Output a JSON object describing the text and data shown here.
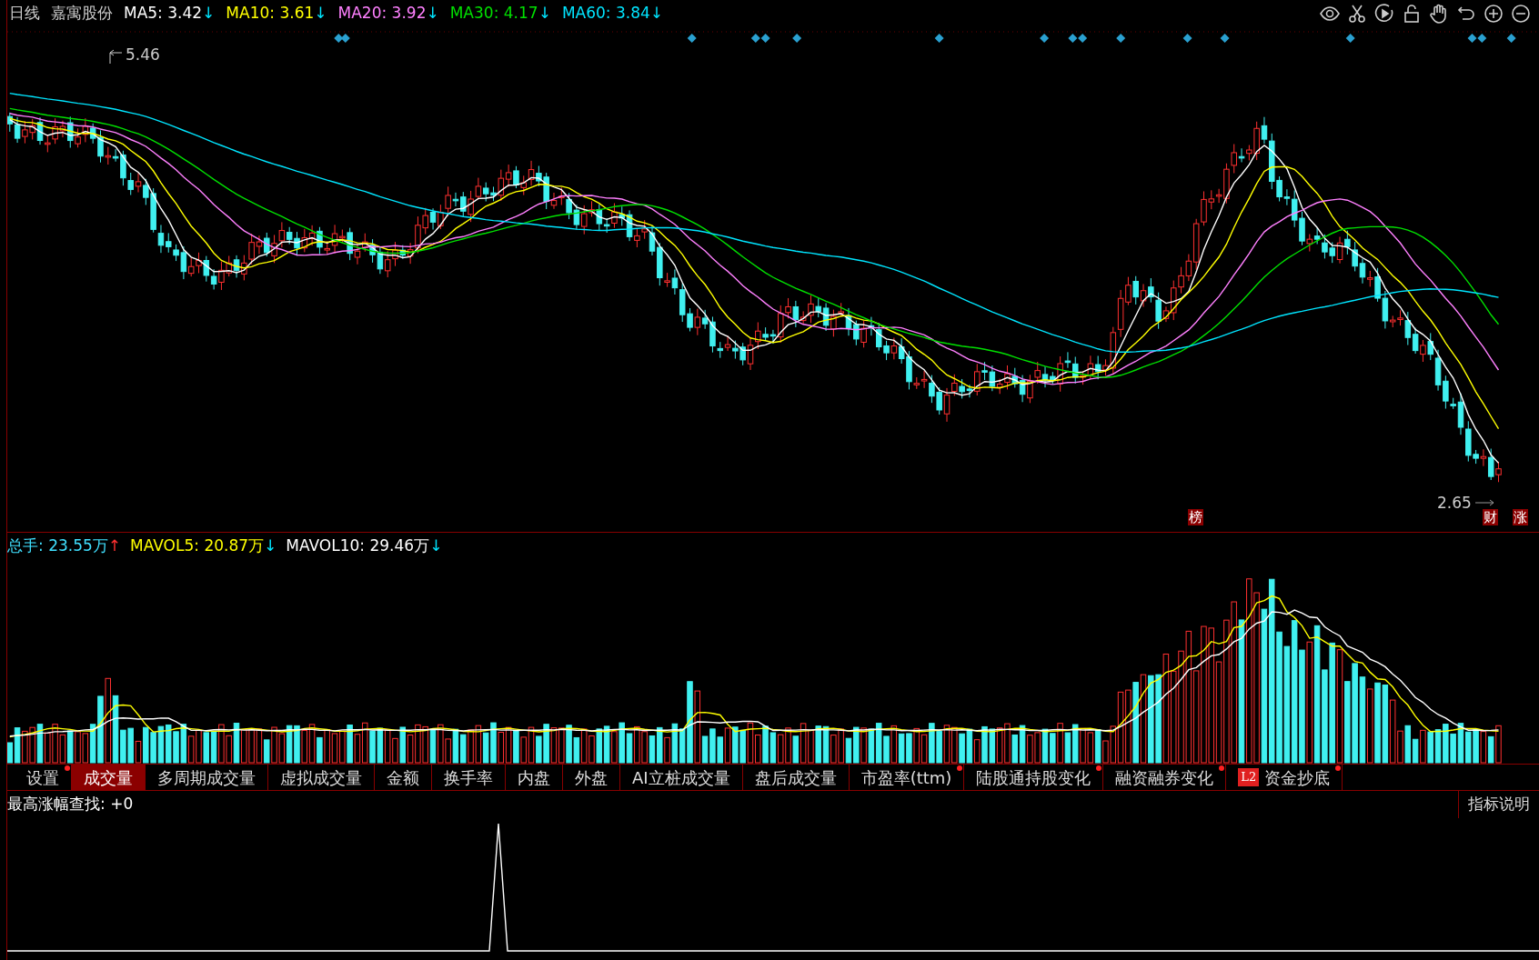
{
  "header": {
    "period": "日线",
    "stock": "嘉寓股份",
    "indicators": [
      {
        "label": "MA5: 3.42",
        "arrow": "↓",
        "color": "#ffffff"
      },
      {
        "label": "MA10: 3.61",
        "arrow": "↓",
        "color": "#ffff00"
      },
      {
        "label": "MA20: 3.92",
        "arrow": "↓",
        "color": "#ff80ff"
      },
      {
        "label": "MA30: 4.17",
        "arrow": "↓",
        "color": "#00e000"
      },
      {
        "label": "MA60: 3.84",
        "arrow": "↓",
        "color": "#00e5ff"
      }
    ]
  },
  "price_chart": {
    "high_label": "5.46",
    "low_label": "2.65",
    "event_markers": [
      {
        "text": "榜"
      },
      {
        "text": "财"
      },
      {
        "text": "涨"
      }
    ]
  },
  "volume": {
    "indicators": [
      {
        "label": "总手: 23.55万",
        "arrow": "↑",
        "color": "#40e0ff"
      },
      {
        "label": "MAVOL5: 20.87万",
        "arrow": "↓",
        "color": "#ffff00"
      },
      {
        "label": "MAVOL10: 29.46万",
        "arrow": "↓",
        "color": "#ffffff"
      }
    ]
  },
  "tabs": [
    {
      "label": "设置",
      "selected": false,
      "dot": true
    },
    {
      "label": "成交量",
      "selected": true,
      "dot": false
    },
    {
      "label": "多周期成交量",
      "selected": false,
      "dot": false
    },
    {
      "label": "虚拟成交量",
      "selected": false,
      "dot": false
    },
    {
      "label": "金额",
      "selected": false,
      "dot": false
    },
    {
      "label": "换手率",
      "selected": false,
      "dot": false
    },
    {
      "label": "内盘",
      "selected": false,
      "dot": false
    },
    {
      "label": "外盘",
      "selected": false,
      "dot": false
    },
    {
      "label": "AI立桩成交量",
      "selected": false,
      "dot": false
    },
    {
      "label": "盘后成交量",
      "selected": false,
      "dot": false
    },
    {
      "label": "市盈率(ttm)",
      "selected": false,
      "dot": true
    },
    {
      "label": "陆股通持股变化",
      "selected": false,
      "dot": true
    },
    {
      "label": "融资融券变化",
      "selected": false,
      "dot": true
    },
    {
      "label": "资金抄底",
      "selected": false,
      "dot": true,
      "badge": "L2"
    }
  ],
  "indicator_panel": {
    "title": "最高涨幅查找: +0",
    "help_button": "指标说明"
  }
}
